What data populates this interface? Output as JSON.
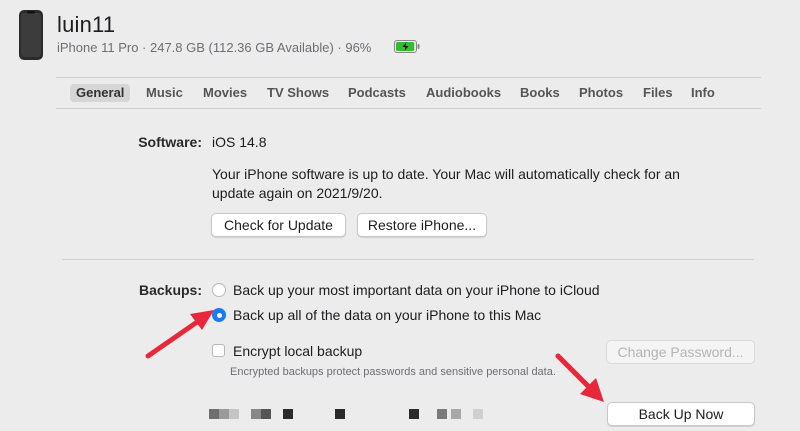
{
  "device": {
    "name": "luin11",
    "subtitle": "iPhone 11 Pro · 247.8 GB (112.36 GB Available) · 96%",
    "battery_percent": 96,
    "battery_color": "#2fbf2f",
    "icon": "iphone-icon"
  },
  "tabs": [
    {
      "label": "General",
      "active": true
    },
    {
      "label": "Music"
    },
    {
      "label": "Movies"
    },
    {
      "label": "TV Shows"
    },
    {
      "label": "Podcasts"
    },
    {
      "label": "Audiobooks"
    },
    {
      "label": "Books"
    },
    {
      "label": "Photos"
    },
    {
      "label": "Files"
    },
    {
      "label": "Info"
    }
  ],
  "software": {
    "label": "Software:",
    "version": "iOS 14.8",
    "status_line1": "Your iPhone software is up to date. Your Mac will automatically check for an",
    "status_line2": "update again on 2021/9/20.",
    "check_button": "Check for Update",
    "restore_button": "Restore iPhone..."
  },
  "backups": {
    "label": "Backups:",
    "option_icloud": "Back up your most important data on your iPhone to iCloud",
    "option_mac": "Back up all of the data on your iPhone to this Mac",
    "selected": "mac",
    "encrypt_label": "Encrypt local backup",
    "encrypt_checked": false,
    "change_password_button": "Change Password...",
    "encrypt_note": "Encrypted backups protect passwords and sensitive personal data.",
    "back_up_now_button": "Back Up Now"
  },
  "colors": {
    "accent": "#1a7cf5",
    "annotation_arrow": "#e8283a"
  }
}
